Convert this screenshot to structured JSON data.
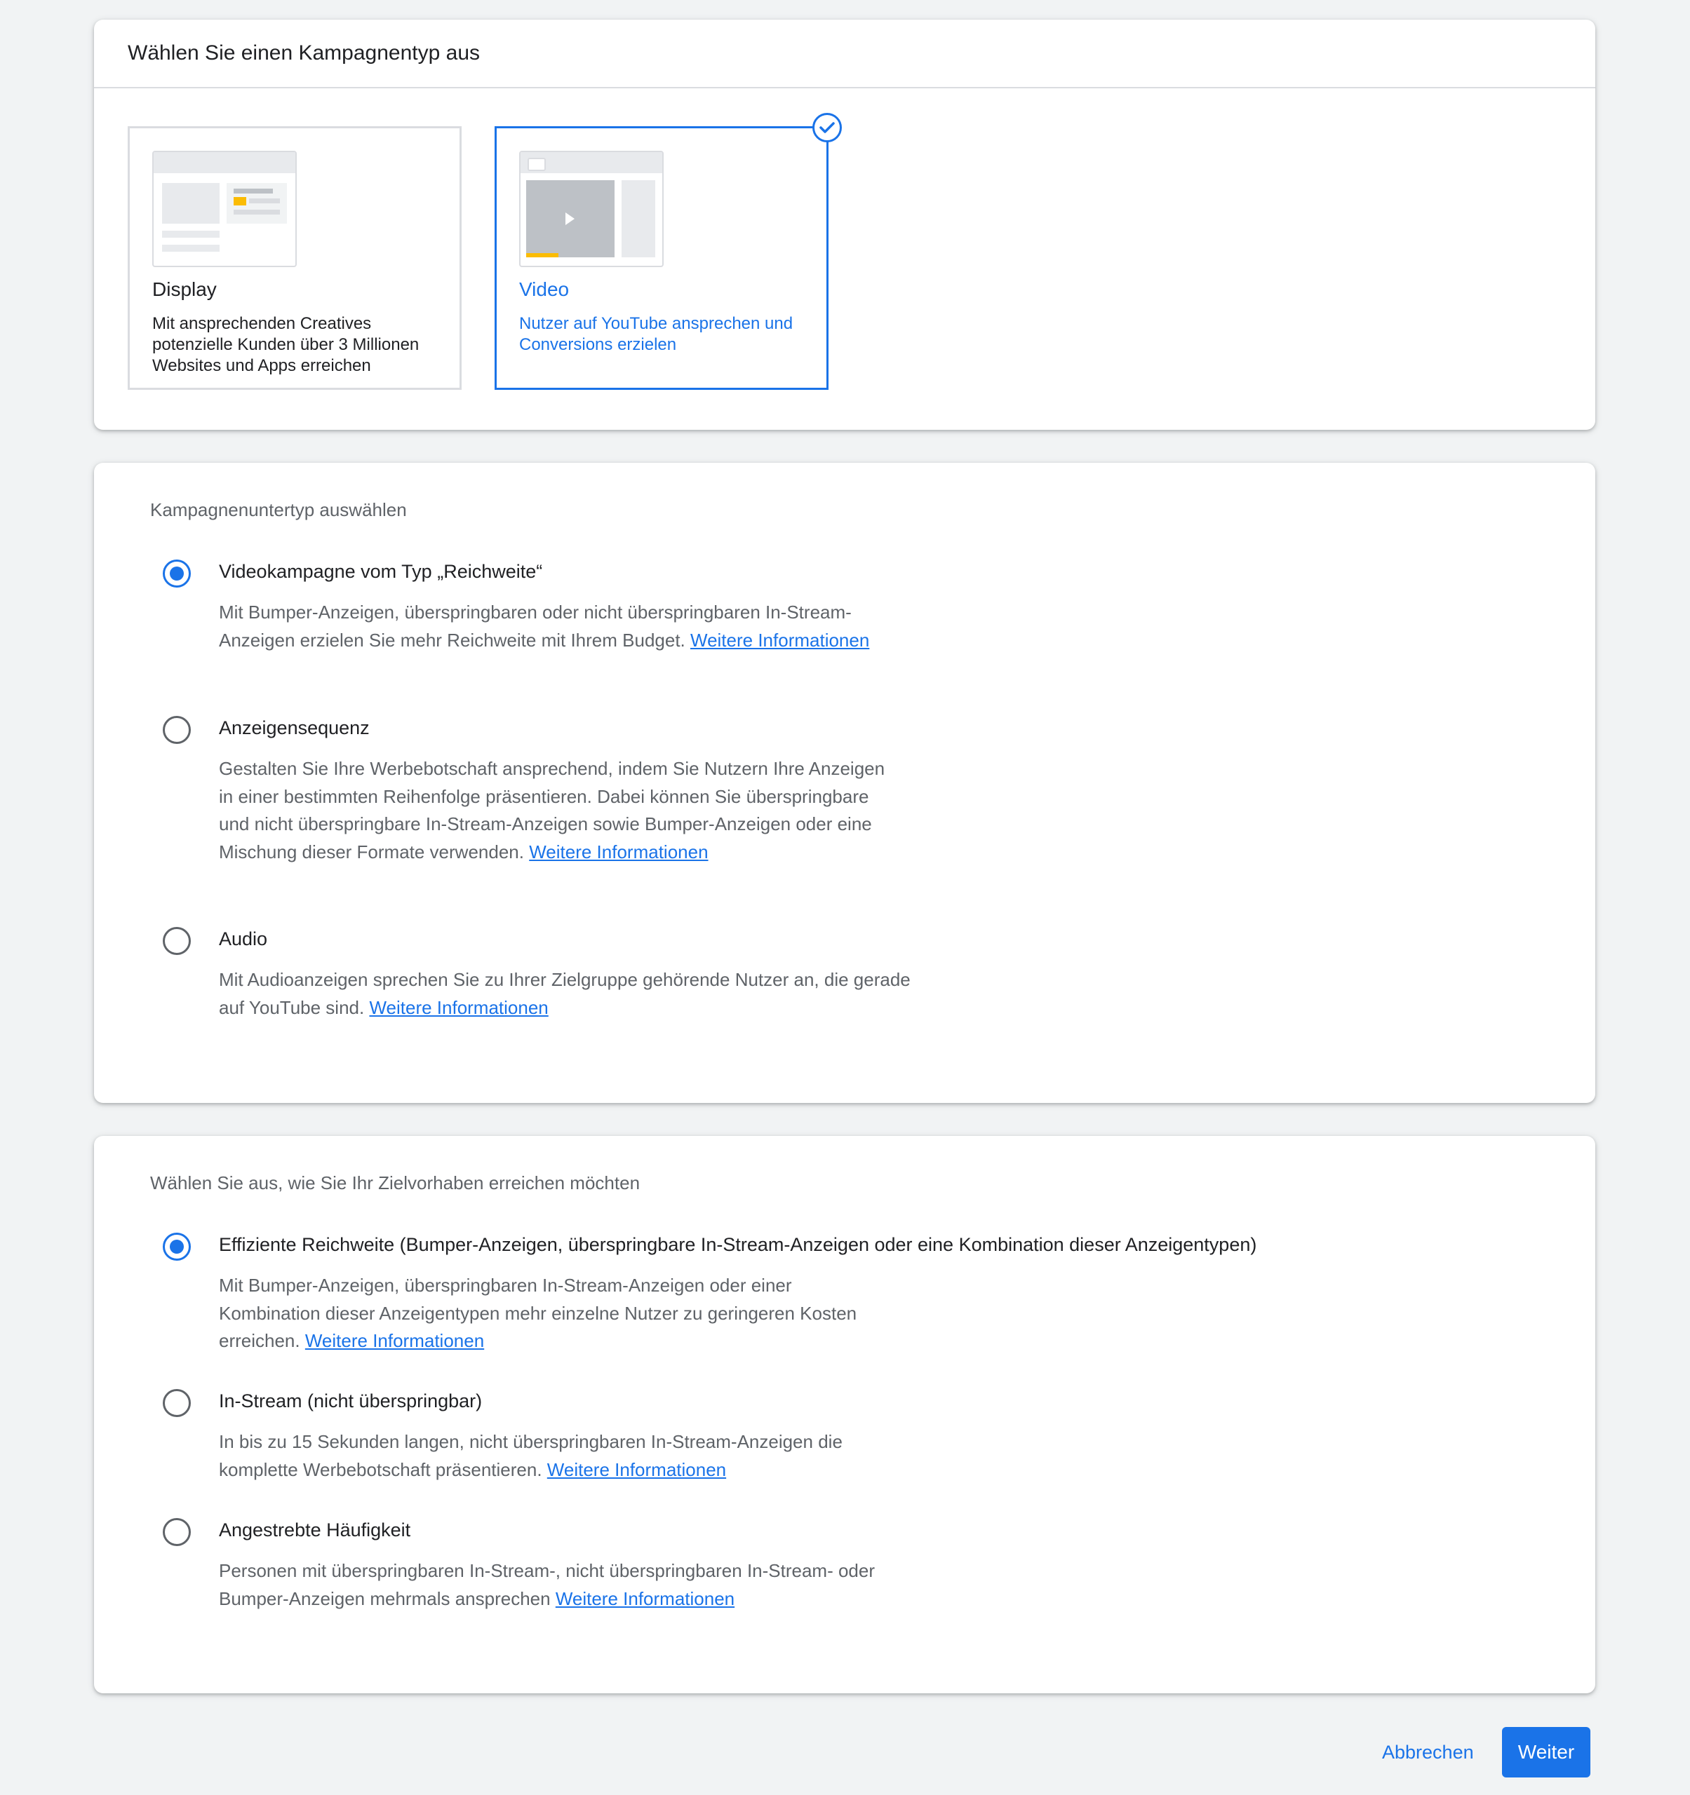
{
  "campaign_type": {
    "heading": "Wählen Sie einen Kampagnentyp aus",
    "tiles": [
      {
        "title": "Display",
        "description": "Mit ansprechenden Creatives potenzielle Kunden über 3 Millionen Websites und Apps erreichen",
        "selected": false
      },
      {
        "title": "Video",
        "description": "Nutzer auf YouTube ansprechen und Conversions erzielen",
        "selected": true
      }
    ]
  },
  "subtype": {
    "label": "Kampagnenuntertyp auswählen",
    "options": [
      {
        "label": "Videokampagne vom Typ „Reichweite“",
        "description": "Mit Bumper-Anzeigen, überspringbaren oder nicht überspringbaren In-Stream-Anzeigen erzielen Sie mehr Reichweite mit Ihrem Budget.",
        "link": "Weitere Informationen",
        "checked": true
      },
      {
        "label": "Anzeigensequenz",
        "description": "Gestalten Sie Ihre Werbebotschaft ansprechend, indem Sie Nutzern Ihre Anzeigen in einer bestimmten Reihenfolge präsentieren. Dabei können Sie überspringbare und nicht überspringbare In-Stream-Anzeigen sowie Bumper-Anzeigen oder eine Mischung dieser Formate verwenden.",
        "link": "Weitere Informationen",
        "checked": false
      },
      {
        "label": "Audio",
        "description": "Mit Audioanzeigen sprechen Sie zu Ihrer Zielgruppe gehörende Nutzer an, die gerade auf YouTube sind.",
        "link": "Weitere Informationen",
        "checked": false
      }
    ]
  },
  "goal": {
    "label": "Wählen Sie aus, wie Sie Ihr Zielvorhaben erreichen möchten",
    "options": [
      {
        "label": "Effiziente Reichweite (Bumper-Anzeigen, überspringbare In-Stream-Anzeigen oder eine Kombination dieser Anzeigentypen)",
        "description": "Mit Bumper-Anzeigen, überspringbaren In-Stream-Anzeigen oder einer Kombination dieser Anzeigentypen mehr einzelne Nutzer zu geringeren Kosten erreichen.",
        "link": "Weitere Informationen",
        "checked": true
      },
      {
        "label": "In-Stream (nicht überspringbar)",
        "description": "In bis zu 15 Sekunden langen, nicht überspringbaren In-Stream-Anzeigen die komplette Werbebotschaft präsentieren.",
        "link": "Weitere Informationen",
        "checked": false
      },
      {
        "label": "Angestrebte Häufigkeit",
        "description": "Personen mit überspringbaren In-Stream-, nicht überspringbaren In-Stream- oder Bumper-Anzeigen mehrmals ansprechen",
        "link": "Weitere Informationen",
        "checked": false
      }
    ]
  },
  "footer": {
    "cancel_label": "Abbrechen",
    "next_label": "Weiter"
  },
  "colors": {
    "accent": "#1a73e8",
    "yellow_accent": "#fbbc04"
  }
}
